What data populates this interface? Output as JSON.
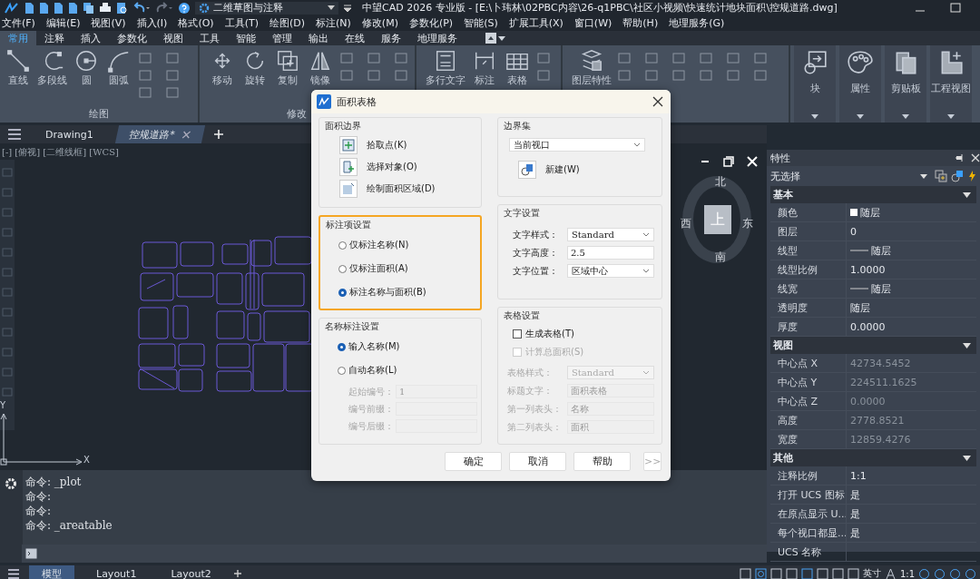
{
  "title_bar": {
    "workspace": "二维草图与注释",
    "title": "中望CAD 2026 专业版 - [E:\\卜玮林\\02PBC内容\\26-q1PBC\\社区小视频\\快速统计地块面积\\控规道路.dwg]"
  },
  "menu_bar": [
    "文件(F)",
    "编辑(E)",
    "视图(V)",
    "插入(I)",
    "格式(O)",
    "工具(T)",
    "绘图(D)",
    "标注(N)",
    "修改(M)",
    "参数化(P)",
    "智能(S)",
    "扩展工具(X)",
    "窗口(W)",
    "帮助(H)",
    "地理服务(G)"
  ],
  "ribbon_tabs": [
    {
      "label": "常用",
      "selected": true
    },
    {
      "label": "注释",
      "selected": false
    },
    {
      "label": "插入",
      "selected": false
    },
    {
      "label": "参数化",
      "selected": false
    },
    {
      "label": "视图",
      "selected": false
    },
    {
      "label": "工具",
      "selected": false
    },
    {
      "label": "智能",
      "selected": false
    },
    {
      "label": "管理",
      "selected": false
    },
    {
      "label": "输出",
      "selected": false
    },
    {
      "label": "在线",
      "selected": false
    },
    {
      "label": "服务",
      "selected": false
    },
    {
      "label": "地理服务",
      "selected": false
    }
  ],
  "ribbon_groups": [
    {
      "label": "绘图",
      "tools": [
        {
          "label": "直线"
        },
        {
          "label": "多段线"
        },
        {
          "label": "圆"
        },
        {
          "label": "圆弧"
        }
      ]
    },
    {
      "label": "修改",
      "tools": [
        {
          "label": "移动"
        },
        {
          "label": "旋转"
        },
        {
          "label": "复制"
        },
        {
          "label": "镜像"
        }
      ]
    },
    {
      "tools": [
        {
          "label": "多行文字"
        },
        {
          "label": "标注"
        },
        {
          "label": "表格"
        }
      ]
    },
    {
      "tools": [
        {
          "label": "图层特性"
        }
      ]
    }
  ],
  "ribbon_panels": [
    {
      "label": "块"
    },
    {
      "label": "属性"
    },
    {
      "label": "剪贴板"
    },
    {
      "label": "工程视图"
    }
  ],
  "doc_tabs": [
    {
      "label": "Drawing1",
      "selected": false
    },
    {
      "label": "控规道路*",
      "selected": true
    }
  ],
  "viewport": {
    "label": "[-] [俯视] [二维线框] [WCS]",
    "compass": {
      "north": "北",
      "south": "南",
      "east": "东",
      "west": "西",
      "center": "上"
    },
    "axis_labels": {
      "x": "X",
      "y": "Y"
    }
  },
  "command_lines": [
    "命令: _plot",
    "命令:",
    "命令:",
    "命令: _areatable"
  ],
  "properties": {
    "title": "特性",
    "selection": "无选择",
    "sections": [
      {
        "title": "基本",
        "expanded": true,
        "rows": [
          {
            "name": "颜色",
            "value": "随层",
            "kind": "swatch"
          },
          {
            "name": "图层",
            "value": "0",
            "kind": "text"
          },
          {
            "name": "线型",
            "value": "随层",
            "kind": "line"
          },
          {
            "name": "线型比例",
            "value": "1.0000",
            "kind": "text"
          },
          {
            "name": "线宽",
            "value": "随层",
            "kind": "line"
          },
          {
            "name": "透明度",
            "value": "随层",
            "kind": "text"
          },
          {
            "name": "厚度",
            "value": "0.0000",
            "kind": "text"
          }
        ]
      },
      {
        "title": "视图",
        "expanded": true,
        "rows": [
          {
            "name": "中心点 X",
            "value": "42734.5452",
            "kind": "readonly"
          },
          {
            "name": "中心点 Y",
            "value": "224511.1625",
            "kind": "readonly"
          },
          {
            "name": "中心点 Z",
            "value": "0.0000",
            "kind": "readonly"
          },
          {
            "name": "高度",
            "value": "2778.8521",
            "kind": "readonly"
          },
          {
            "name": "宽度",
            "value": "12859.4276",
            "kind": "readonly"
          }
        ]
      },
      {
        "title": "其他",
        "expanded": true,
        "rows": [
          {
            "name": "注释比例",
            "value": "1:1",
            "kind": "text"
          },
          {
            "name": "打开 UCS 图标",
            "value": "是",
            "kind": "text"
          },
          {
            "name": "在原点显示 U...",
            "value": "是",
            "kind": "text"
          },
          {
            "name": "每个视口都显...",
            "value": "是",
            "kind": "text"
          },
          {
            "name": "UCS 名称",
            "kind": "text"
          }
        ]
      }
    ]
  },
  "status_bar": {
    "tabs": [
      {
        "label": "模型",
        "selected": true
      },
      {
        "label": "Layout1",
        "selected": false
      },
      {
        "label": "Layout2",
        "selected": false
      }
    ],
    "unit": "英寸",
    "scale": "1:1"
  },
  "dialog": {
    "title": "面积表格",
    "boundary": {
      "title": "面积边界",
      "actions": [
        {
          "label": "拾取点(K)"
        },
        {
          "label": "选择对象(O)"
        },
        {
          "label": "绘制面积区域(D)"
        }
      ]
    },
    "label_mode": {
      "title": "标注项设置",
      "highlighted": true,
      "options": [
        {
          "label": "仅标注名称(N)",
          "selected": false
        },
        {
          "label": "仅标注面积(A)",
          "selected": false
        },
        {
          "label": "标注名称与面积(B)",
          "selected": true
        }
      ]
    },
    "naming": {
      "title": "名称标注设置",
      "options": [
        {
          "label": "输入名称(M)",
          "selected": true
        },
        {
          "label": "自动名称(L)",
          "selected": false
        }
      ],
      "fields": [
        {
          "label": "起始编号：",
          "value": "1",
          "kind": "input",
          "disabled": true
        },
        {
          "label": "编号前缀：",
          "kind": "input",
          "disabled": true
        },
        {
          "label": "编号后缀：",
          "kind": "input",
          "disabled": true
        }
      ]
    },
    "boundary_set": {
      "title": "边界集",
      "value": "当前视口",
      "new_button": "新建(W)"
    },
    "text_settings": {
      "title": "文字设置",
      "fields": [
        {
          "label": "文字样式：",
          "value": "Standard",
          "kind": "dropdown",
          "disabled": false
        },
        {
          "label": "文字高度：",
          "value": "2.5",
          "kind": "input",
          "disabled": false
        },
        {
          "label": "文字位置：",
          "value": "区域中心",
          "kind": "dropdown",
          "disabled": false
        }
      ]
    },
    "table_settings": {
      "title": "表格设置",
      "checkboxes": [
        {
          "label": "生成表格(T)",
          "checked": false,
          "disabled": false
        },
        {
          "label": "计算总面积(S)",
          "checked": false,
          "disabled": true
        }
      ],
      "fields": [
        {
          "label": "表格样式：",
          "value": "Standard",
          "kind": "dropdown",
          "disabled": true
        },
        {
          "label": "标题文字：",
          "value": "面积表格",
          "kind": "input",
          "disabled": true
        },
        {
          "label": "第一列表头：",
          "value": "名称",
          "kind": "input",
          "disabled": true
        },
        {
          "label": "第二列表头：",
          "value": "面积",
          "kind": "input",
          "disabled": true
        }
      ]
    },
    "buttons": [
      "确定",
      "取消",
      "帮助",
      ">>"
    ]
  }
}
